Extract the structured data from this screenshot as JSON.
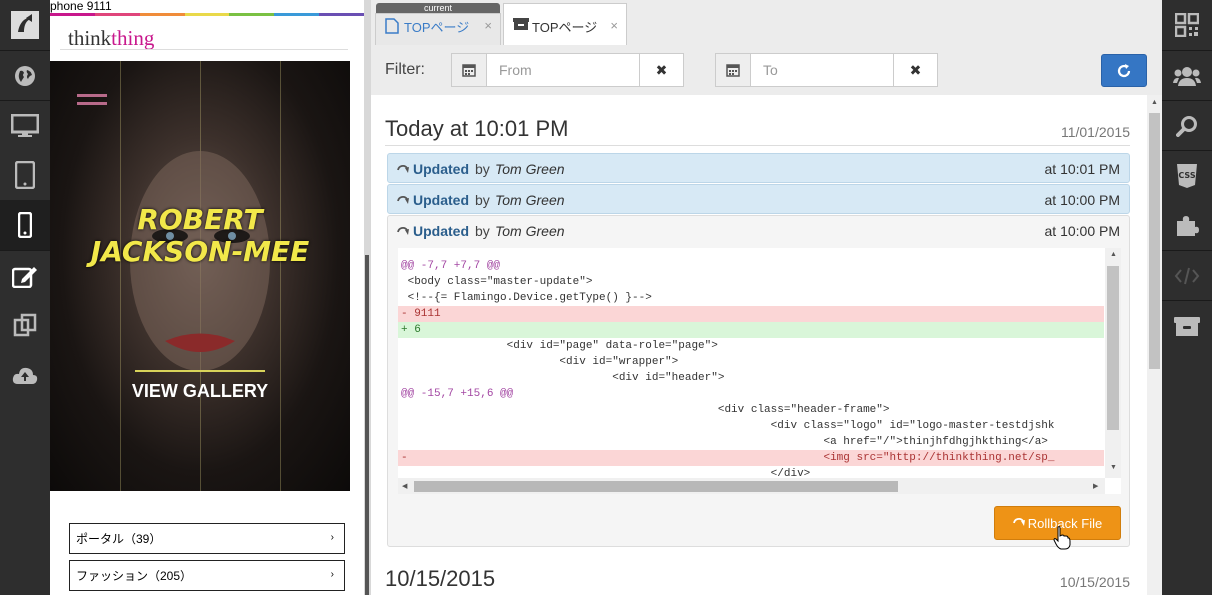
{
  "preview": {
    "device_label": "phone 9111",
    "strip_colors": [
      "#c8178c",
      "#e0457b",
      "#f08c3a",
      "#e9d94a",
      "#7ac143",
      "#3a9ad9",
      "#6a4fb3"
    ],
    "site": {
      "logo_plain": "think",
      "logo_accent": "thing",
      "accent_color": "#c8178c"
    },
    "hero": {
      "title_line1": "ROBERT",
      "title_line2": "JACKSON-MEE",
      "cta": "VIEW GALLERY"
    },
    "categories": [
      {
        "label": "ポータル（39）",
        "chevron": "›"
      },
      {
        "label": "ファッション（205）",
        "chevron": "›"
      }
    ]
  },
  "left_toolbar": [
    "logo-icon",
    "globe-icon",
    "desktop-icon",
    "tablet-icon",
    "phone-icon",
    "edit-icon",
    "copy-icon",
    "upload-cloud-icon"
  ],
  "right_toolbar": [
    "qr-code-icon",
    "users-icon",
    "search-icon",
    "css-icon",
    "puzzle-icon",
    "code-icon",
    "archive-icon"
  ],
  "tabs": {
    "current_badge": "current",
    "items": [
      {
        "label": "TOPページ",
        "close": "×",
        "icon": "file-icon"
      },
      {
        "label": "TOPページ",
        "close": "×",
        "icon": "archive-icon"
      }
    ]
  },
  "filter": {
    "label": "Filter:",
    "from_placeholder": "From",
    "to_placeholder": "To",
    "clear_symbol": "✖",
    "accent_color": "#3576c4"
  },
  "history": {
    "groups": [
      {
        "heading": "Today at 10:01 PM",
        "date": "11/01/2015",
        "entries": [
          {
            "action": "Updated",
            "by": "by",
            "user": "Tom Green",
            "time": "at 10:01 PM"
          },
          {
            "action": "Updated",
            "by": "by",
            "user": "Tom Green",
            "time": "at 10:00 PM"
          },
          {
            "action": "Updated",
            "by": "by",
            "user": "Tom Green",
            "time": "at 10:00 PM"
          }
        ]
      },
      {
        "heading": "10/15/2015",
        "date": "10/15/2015"
      }
    ],
    "diff": [
      {
        "type": "hunk",
        "text": "@@ -7,7 +7,7 @@"
      },
      {
        "type": "ctx",
        "text": " <body class=\"master-update\">"
      },
      {
        "type": "ctx",
        "text": " <!--{= Flamingo.Device.getType() }-->"
      },
      {
        "type": "del",
        "text": "- 9111"
      },
      {
        "type": "add",
        "text": "+ 6"
      },
      {
        "type": "ctx",
        "text": "                <div id=\"page\" data-role=\"page\">"
      },
      {
        "type": "ctx",
        "text": "                        <div id=\"wrapper\">"
      },
      {
        "type": "ctx",
        "text": "                                <div id=\"header\">"
      },
      {
        "type": "hunk",
        "text": "@@ -15,7 +15,6 @@"
      },
      {
        "type": "ctx",
        "text": "                                                <div class=\"header-frame\">"
      },
      {
        "type": "ctx",
        "text": "                                                        <div class=\"logo\" id=\"logo-master-testdjshk"
      },
      {
        "type": "ctx",
        "text": "                                                                <a href=\"/\">thinjhfdhgjhkthing</a>"
      },
      {
        "type": "del",
        "text": "-                                                               <img src=\"http://thinkthing.net/sp_"
      },
      {
        "type": "ctx",
        "text": "                                                        </div>"
      }
    ],
    "rollback_label": "Rollback File",
    "rollback_color": "#ee9316"
  }
}
